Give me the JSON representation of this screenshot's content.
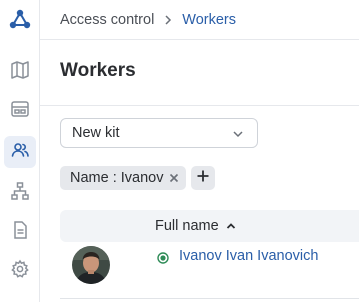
{
  "sidebar": {
    "logo_icon": "network-logo-icon",
    "items": [
      {
        "icon": "map-icon",
        "active": false
      },
      {
        "icon": "dashboard-grid-icon",
        "active": false
      },
      {
        "icon": "users-icon",
        "active": true
      },
      {
        "icon": "hierarchy-icon",
        "active": false
      },
      {
        "icon": "document-icon",
        "active": false
      },
      {
        "icon": "gear-icon",
        "active": false
      }
    ]
  },
  "breadcrumb": {
    "root": "Access control",
    "current": "Workers"
  },
  "page": {
    "title": "Workers"
  },
  "kit_select": {
    "value": "New kit"
  },
  "filters": [
    {
      "label": "Name : Ivanov"
    }
  ],
  "table": {
    "columns": [
      {
        "label": "Full name",
        "sort": "ascending"
      }
    ],
    "rows": [
      {
        "name": "Ivanov Ivan Ivanovich",
        "status": "active"
      }
    ]
  },
  "colors": {
    "accent": "#2a5ea8",
    "status_active": "#2e8b57",
    "active_nav_bg": "#e9eef7"
  }
}
